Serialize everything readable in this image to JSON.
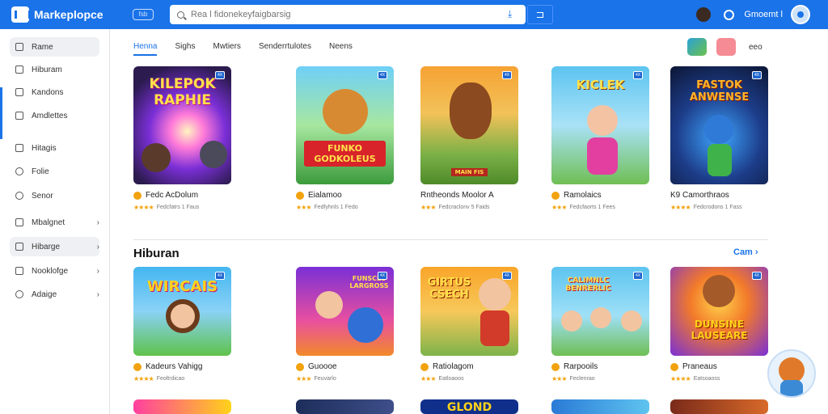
{
  "app": {
    "logo_text": "Markeplopce",
    "chip_label": "fsb"
  },
  "search": {
    "placeholder": "Rea l fidonekeyfaigbarsig"
  },
  "topbar": {
    "user_name": "Gmoemt l"
  },
  "sidebar": {
    "items": [
      {
        "label": "Rame"
      },
      {
        "label": "Hiburam"
      },
      {
        "label": "Kandons"
      },
      {
        "label": "Amdlettes"
      },
      {
        "label": "Hitagis"
      },
      {
        "label": "Folie"
      },
      {
        "label": "Senor"
      },
      {
        "label": "Mbalgnet"
      },
      {
        "label": "Hibarge"
      },
      {
        "label": "Nooklofge"
      },
      {
        "label": "Adaige"
      }
    ]
  },
  "tabs": [
    {
      "label": "Henna"
    },
    {
      "label": "Sighs"
    },
    {
      "label": "Mwtiers"
    },
    {
      "label": "Senderrtulotes"
    },
    {
      "label": "Neens"
    }
  ],
  "toolbar": {
    "more_label": "eeo"
  },
  "section1": {
    "cards": [
      {
        "art_text": "KILEPOK RAPHIE",
        "badge": "4X",
        "title": "Fedc AcDolum",
        "meta": "Fedcfatrs 1 Faus"
      },
      {
        "art_text": "FUNKO GODKOLEUS",
        "badge": "4X",
        "title": "Eialamoo",
        "meta": "Fedfyhnls 1 Fedo"
      },
      {
        "art_text": "MAIN FIS",
        "badge": "4X",
        "title": "Rntheonds Moolor A",
        "meta": "Fedcraclonv 5 Faids"
      },
      {
        "art_text": "KICLEK",
        "badge": "4X",
        "title": "Ramolaics",
        "meta": "Fedcfaorts 1 Fees"
      },
      {
        "art_text": "FASTOK ANWENSE",
        "badge": "4X",
        "title": "K9 Camorthraos",
        "meta": "Fedcrodons 1 Fass"
      }
    ]
  },
  "section2": {
    "title": "Hiburan",
    "see_all": "Cam",
    "cards": [
      {
        "art_text": "WIRCAIS",
        "badge": "4X",
        "title": "Kadeurs Vahigg",
        "meta": "Feoltrdicao"
      },
      {
        "art_text": "FUNSCES LARGROSS",
        "badge": "4X",
        "title": "Guoooe",
        "meta": "Feuvarlo"
      },
      {
        "art_text": "GIRTUS CSECH",
        "badge": "4X",
        "title": "Ratiolagom",
        "meta": "Eatloaoos"
      },
      {
        "art_text": "CALIMNLC BENRERLIC",
        "badge": "4X",
        "title": "Rarpooils",
        "meta": "Feclenrao"
      },
      {
        "art_text": "DUNSINE LAUSEARE",
        "badge": "4X",
        "title": "Praneaus",
        "meta": "Eatsoaoss"
      }
    ]
  },
  "section3": {
    "cards": [
      {
        "art_text": ""
      },
      {
        "art_text": ""
      },
      {
        "art_text": "GLOND"
      },
      {
        "art_text": ""
      },
      {
        "art_text": ""
      }
    ]
  },
  "colors": {
    "brand": "#1a73e8",
    "star": "#f2a20d"
  }
}
